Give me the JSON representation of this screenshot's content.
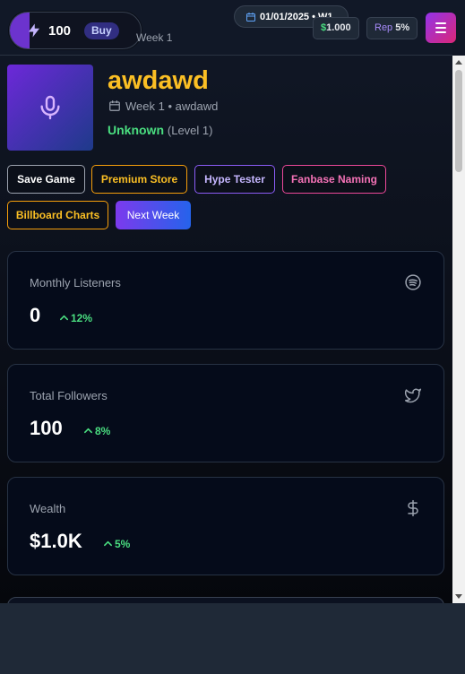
{
  "header": {
    "energy": {
      "amount": "100",
      "buy_label": "Buy",
      "icon": "bolt-icon"
    },
    "week_peek": "Week 1",
    "date_label": "01/01/2025 • W1",
    "money": {
      "symbol": "$",
      "value": "1.000"
    },
    "reputation": {
      "label": "Rep",
      "value": "5%"
    },
    "menu_icon": "hamburger-icon"
  },
  "artist": {
    "name": "awdawd",
    "subtitle": "Week 1 • awdawd",
    "status": "Unknown",
    "level": "(Level 1)",
    "avatar_icon": "microphone-icon"
  },
  "actions": {
    "save": "Save Game",
    "premium": "Premium Store",
    "hype": "Hype Tester",
    "fanbase": "Fanbase Naming",
    "billboard": "Billboard Charts",
    "next_week": "Next Week"
  },
  "stats": [
    {
      "label": "Monthly Listeners",
      "value": "0",
      "change": "12%",
      "icon": "spotify-icon"
    },
    {
      "label": "Total Followers",
      "value": "100",
      "change": "8%",
      "icon": "twitter-icon"
    },
    {
      "label": "Wealth",
      "value": "$1.0K",
      "change": "5%",
      "icon": "dollar-icon"
    }
  ],
  "colors": {
    "accent_gold": "#fbbf24",
    "positive_green": "#4ade80",
    "purple": "#7c3aed",
    "pink": "#ec4899"
  }
}
